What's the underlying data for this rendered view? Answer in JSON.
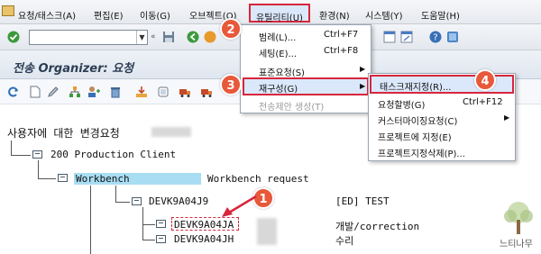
{
  "menubar": {
    "items": [
      "요청/태스크(A)",
      "편집(E)",
      "이동(G)",
      "오브젝트(O)",
      "유틸리티(U)",
      "환경(N)",
      "시스템(Y)",
      "도움말(H)"
    ]
  },
  "title": "전송 Organizer: 요청",
  "utility_menu": {
    "items": [
      {
        "label": "범례(L)...",
        "shortcut": "Ctrl+F7"
      },
      {
        "label": "세팅(E)...",
        "shortcut": "Ctrl+F8"
      },
      {
        "label": "표준요청(S)",
        "shortcut": ""
      },
      {
        "label": "재구성(G)",
        "shortcut": ""
      },
      {
        "label": "전송제안 생성(T)",
        "shortcut": ""
      }
    ]
  },
  "regroup_menu": {
    "items": [
      {
        "label": "태스크재지정(R)...",
        "shortcut": ""
      },
      {
        "label": "요청할병(G)",
        "shortcut": "Ctrl+F12"
      },
      {
        "label": "커스터마이징요청(C)",
        "shortcut": ""
      },
      {
        "label": "프로젝트에 지정(E)",
        "shortcut": ""
      },
      {
        "label": "프로젝트지정삭제(P)...",
        "shortcut": ""
      }
    ]
  },
  "tree": {
    "root": "사용자에 대한 변경요청",
    "client": "200 Production Client",
    "workbench": "Workbench",
    "workbench_desc": "Workbench request",
    "request_id": "DEVK9A04J9",
    "request_desc": "[ED] TEST",
    "task1_id": "DEVK9A04JA",
    "task1_desc": "개발/correction",
    "task2_id": "DEVK9A04JH",
    "task2_desc": "수리"
  },
  "badges": [
    "1",
    "2",
    "3",
    "4"
  ],
  "watermark": "느티나무",
  "colors": {
    "callout": "#e8583a",
    "highlight_border": "#d7263d",
    "selection_bg": "#dbe8fb"
  }
}
